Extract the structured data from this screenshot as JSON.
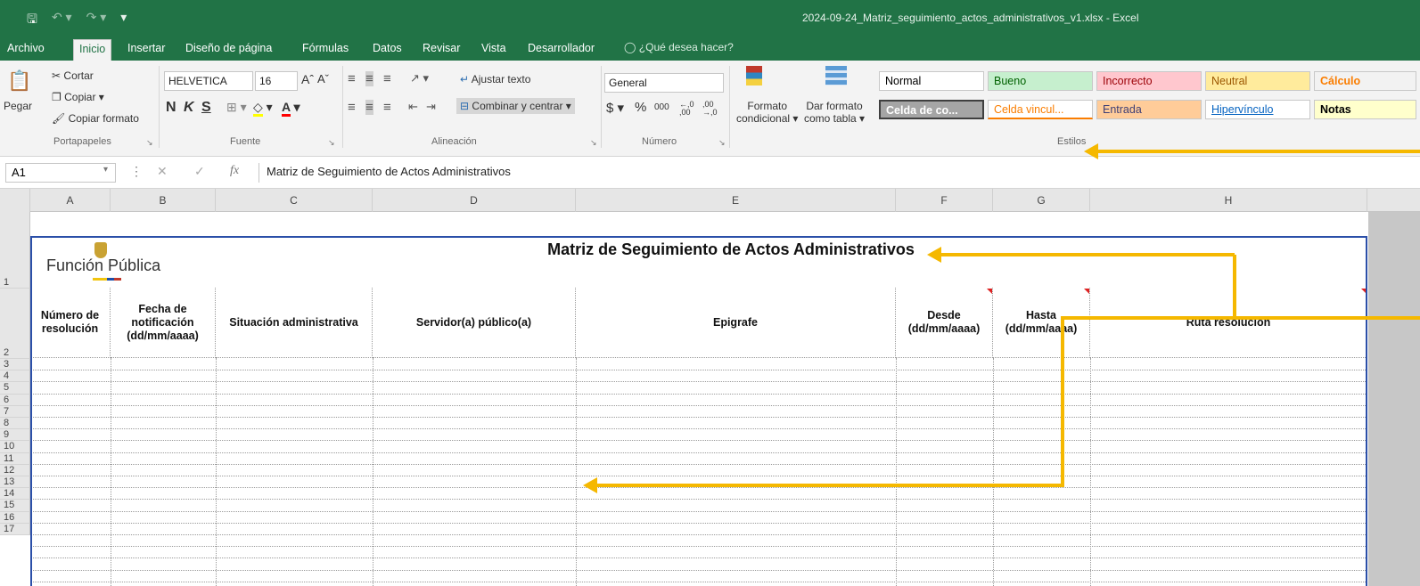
{
  "window": {
    "title": "2024-09-24_Matriz_seguimiento_actos_administrativos_v1.xlsx - Excel"
  },
  "quick_access": {
    "save_icon": "save-icon",
    "undo_icon": "undo-icon",
    "redo_icon": "redo-icon"
  },
  "tabs": [
    "Archivo",
    "Inicio",
    "Insertar",
    "Diseño de página",
    "Fórmulas",
    "Datos",
    "Revisar",
    "Vista",
    "Desarrollador"
  ],
  "tell_me": "¿Qué desea hacer?",
  "ribbon": {
    "clipboard": {
      "paste": "Pegar",
      "cut": "Cortar",
      "copy": "Copiar",
      "format_painter": "Copiar formato",
      "label": "Portapapeles"
    },
    "font": {
      "name": "HELVETICA",
      "size": "16",
      "bold": "N",
      "italic": "K",
      "underline": "S",
      "label": "Fuente"
    },
    "alignment": {
      "wrap_text": "Ajustar texto",
      "merge_center": "Combinar y centrar",
      "label": "Alineación"
    },
    "number": {
      "format": "General",
      "currency": "$",
      "percent": "%",
      "thousands": "000",
      "inc_decimals": "←,0 ,00",
      "dec_decimals": ",00 →,0",
      "label": "Número"
    },
    "styles": {
      "conditional_line1": "Formato",
      "conditional_line2": "condicional",
      "table_line1": "Dar formato",
      "table_line2": "como tabla",
      "cells": [
        {
          "label": "Normal",
          "bg": "#ffffff",
          "fg": "#000000"
        },
        {
          "label": "Bueno",
          "bg": "#c6efce",
          "fg": "#006100"
        },
        {
          "label": "Incorrecto",
          "bg": "#ffc7ce",
          "fg": "#9c0006"
        },
        {
          "label": "Neutral",
          "bg": "#ffeb9c",
          "fg": "#9c5700"
        },
        {
          "label": "Cálculo",
          "bg": "#f2f2f2",
          "fg": "#fa7d00"
        },
        {
          "label": "Celda de co...",
          "bg": "#a5a5a5",
          "fg": "#ffffff"
        },
        {
          "label": "Celda vincul...",
          "bg": "#ffffff",
          "fg": "#fa7d00"
        },
        {
          "label": "Entrada",
          "bg": "#ffcc99",
          "fg": "#3f3f76"
        },
        {
          "label": "Hipervínculo",
          "bg": "#ffffff",
          "fg": "#0563c1"
        },
        {
          "label": "Notas",
          "bg": "#ffffcc",
          "fg": "#000000"
        }
      ],
      "label": "Estilos"
    }
  },
  "formula_bar": {
    "name_box": "A1",
    "fx": "fx",
    "content": "Matriz de Seguimiento de Actos Administrativos"
  },
  "columns": [
    "A",
    "B",
    "C",
    "D",
    "E",
    "F",
    "G",
    "H"
  ],
  "rows": [
    "1",
    "2",
    "3",
    "4",
    "5",
    "6",
    "7",
    "8",
    "9",
    "10",
    "11",
    "12",
    "13",
    "14",
    "15",
    "16",
    "17"
  ],
  "sheet": {
    "logo_text": "Función Pública",
    "title": "Matriz de Seguimiento de Actos Administrativos",
    "headers": [
      "Número de resolución",
      "Fecha de notificación (dd/mm/aaaa)",
      "Situación administrativa",
      "Servidor(a) público(a)",
      "Epigrafe",
      "Desde (dd/mm/aaaa)",
      "Hasta (dd/mm/aaaa)",
      "Ruta resolución"
    ]
  },
  "colors": {
    "excel_green": "#217346",
    "arrow": "#f5b800",
    "selection_border": "#2b4fa8"
  }
}
